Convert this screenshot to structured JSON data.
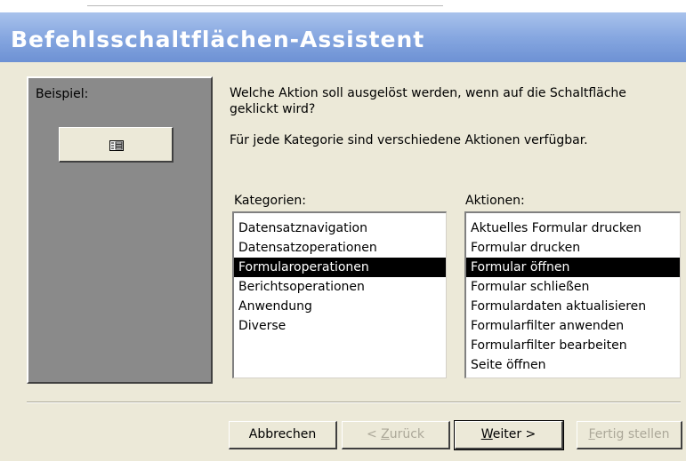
{
  "window": {
    "title": "Befehlsschaltflächen-Assistent"
  },
  "preview": {
    "label": "Beispiel:",
    "icon": "form-icon"
  },
  "prompt": {
    "question": "Welche Aktion soll ausgelöst werden, wenn auf die Schaltfläche geklickt wird?",
    "info": "Für jede Kategorie sind verschiedene Aktionen verfügbar."
  },
  "categories": {
    "label": "Kategorien:",
    "items": [
      "Datensatznavigation",
      "Datensatzoperationen",
      "Formularoperationen",
      "Berichtsoperationen",
      "Anwendung",
      "Diverse"
    ],
    "selected": "Formularoperationen"
  },
  "actions": {
    "label": "Aktionen:",
    "items": [
      "Aktuelles Formular drucken",
      "Formular drucken",
      "Formular öffnen",
      "Formular schließen",
      "Formulardaten aktualisieren",
      "Formularfilter anwenden",
      "Formularfilter bearbeiten",
      "Seite öffnen"
    ],
    "selected": "Formular öffnen"
  },
  "buttons": {
    "cancel": "Abbrechen",
    "back_prefix": "< ",
    "back_mnemonic": "Z",
    "back_rest": "urück",
    "next_mnemonic": "W",
    "next_rest": "eiter >",
    "finish_mnemonic": "F",
    "finish_rest": "ertig stellen"
  },
  "colors": {
    "titlebar": "#86a7e0",
    "selection": "#000000",
    "panel": "#8a8a8a",
    "dialog": "#ece9d8"
  }
}
